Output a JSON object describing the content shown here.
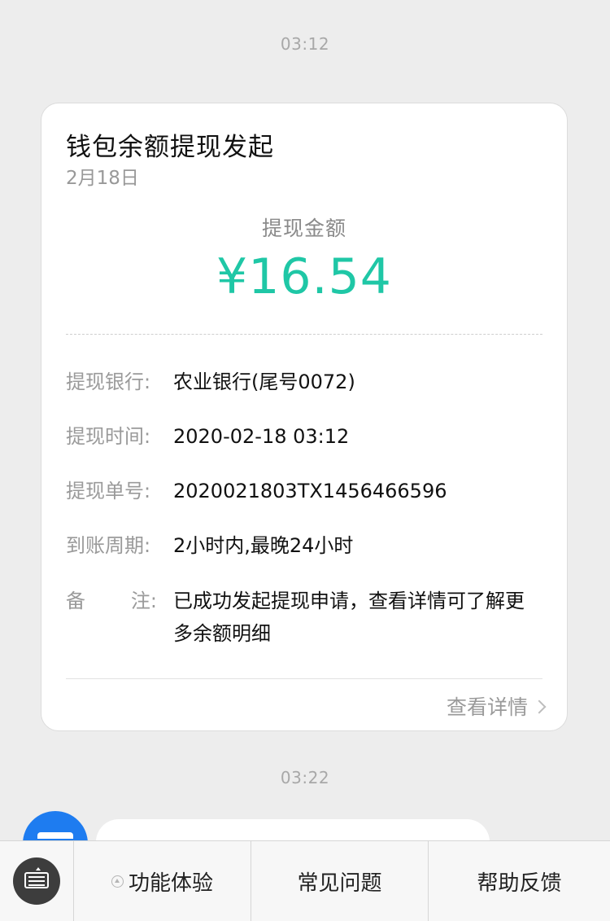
{
  "chat": {
    "timestamp_1": "03:12",
    "timestamp_2": "03:22"
  },
  "card": {
    "title": "钱包余额提现发起",
    "date": "2月18日",
    "amount_label": "提现金额",
    "amount_value": "¥16.54",
    "accent_color": "#1fc7a6",
    "rows": [
      {
        "label": "提现银行:",
        "value": "农业银行(尾号0072)"
      },
      {
        "label": "提现时间:",
        "value": "2020-02-18 03:12"
      },
      {
        "label": "提现单号:",
        "value": "2020021803TX1456466596"
      },
      {
        "label": "到账周期:",
        "value": "2小时内,最晚24小时"
      },
      {
        "label_start": "备",
        "label_end": "注:",
        "value": "已成功发起提现申请，查看详情可了解更多余额明细"
      }
    ],
    "view_details": "查看详情"
  },
  "bottom_menu": {
    "keyboard_icon": "keyboard-icon",
    "tabs": [
      {
        "label": "功能体验",
        "icon": "submenu-indicator-icon"
      },
      {
        "label": "常见问题"
      },
      {
        "label": "帮助反馈"
      }
    ]
  },
  "avatar": {
    "icon": "bank-card-icon",
    "color": "#1e7cf0"
  }
}
